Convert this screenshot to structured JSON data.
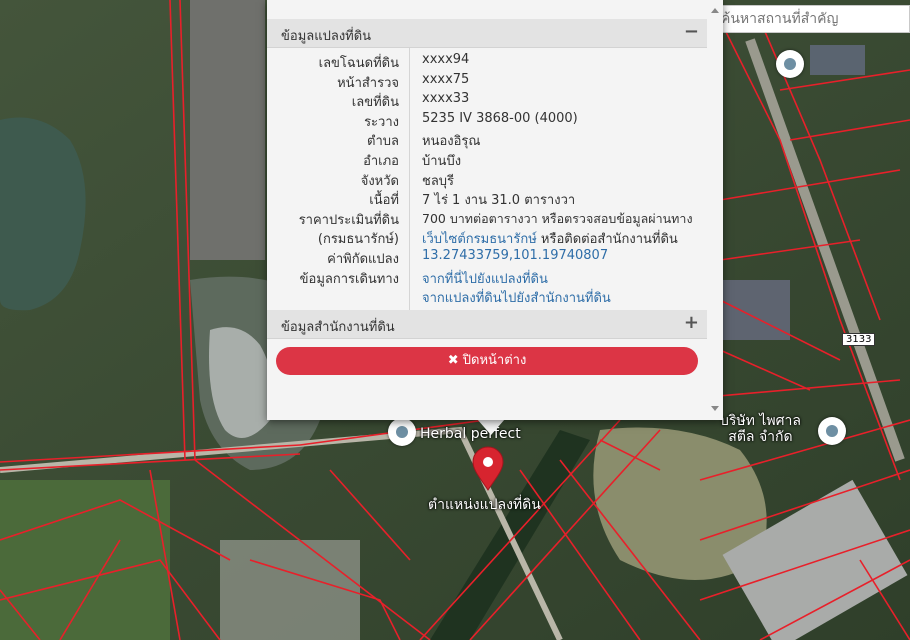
{
  "search": {
    "placeholder": "ค้นหาสถานที่สำคัญ"
  },
  "map": {
    "pois": [
      {
        "name": "Herbal perfect"
      },
      {
        "name": "บริษัท ไพศาล\nสตีล จำกัด"
      }
    ],
    "road_number": "3133",
    "parcel_marker_label": "ตำแหน่งแปลงที่ดิน",
    "boundary_color": "#e8202a",
    "marker_color": "#d7242f"
  },
  "popup": {
    "section1_title": "ข้อมูลแปลงที่ดิน",
    "section1_toggle": "−",
    "rows": [
      {
        "label": "เลขโฉนดที่ดิน",
        "value": "xxxx94"
      },
      {
        "label": "หน้าสำรวจ",
        "value": "xxxx75"
      },
      {
        "label": "เลขที่ดิน",
        "value": "xxxx33"
      },
      {
        "label": "ระวาง",
        "value": "5235 IV 3868-00 (4000)"
      },
      {
        "label": "ตำบล",
        "value": "หนองอิรุณ"
      },
      {
        "label": "อำเภอ",
        "value": "บ้านบึง"
      },
      {
        "label": "จังหวัด",
        "value": "ชลบุรี"
      },
      {
        "label": "เนื้อที่",
        "value": "7 ไร่ 1 งาน 31.0 ตารางวา"
      },
      {
        "label": "ราคาประเมินที่ดิน",
        "value": "700 บาทต่อตารางวา หรือตรวจสอบข้อมูลผ่านทาง"
      }
    ],
    "treasury_row": {
      "label": "(กรมธนารักษ์)",
      "link": "เว็บไซต์กรมธนารักษ์",
      "suffix": " หรือติดต่อสำนักงานที่ดิน"
    },
    "coord_row": {
      "label": "ค่าพิกัดแปลง",
      "value": "13.27433759,101.19740807"
    },
    "route_row": {
      "label": "ข้อมูลการเดินทาง",
      "link1": "จากที่นี่ไปยังแปลงที่ดิน",
      "link2": "จากแปลงที่ดินไปยังสำนักงานที่ดิน"
    },
    "section2_title": "ข้อมูลสำนักงานที่ดิน",
    "section2_toggle": "+",
    "close_icon": "✖",
    "close_label": "ปิดหน้าต่าง",
    "accent": "#dc3545"
  }
}
